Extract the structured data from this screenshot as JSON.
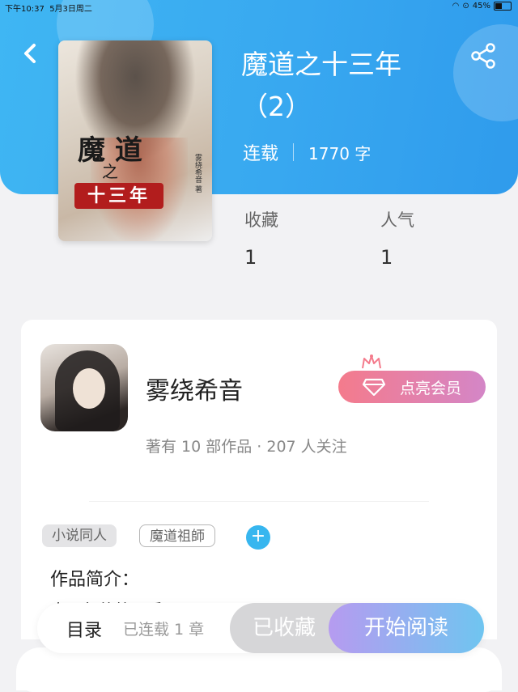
{
  "status_bar": {
    "time": "下午10:37",
    "date": "5月3日周二",
    "battery": "45%"
  },
  "book": {
    "title": "魔道之十三年（2）",
    "status": "连载",
    "word_count": "1770 字",
    "cover_title_top": "魔 道",
    "cover_title_mid": "之",
    "cover_banner": "十三年",
    "cover_author": "雾绕希音 著"
  },
  "stats": {
    "favorites_label": "收藏",
    "favorites_value": "1",
    "popularity_label": "人气",
    "popularity_value": "1"
  },
  "author": {
    "name": "雾绕希音",
    "vip_label": "点亮会员",
    "works_info": "著有 10 部作品 · 207 人关注"
  },
  "tags": [
    "小说同人",
    "魔道祖師"
  ],
  "intro": {
    "label": "作品简介：",
    "text": "十三年的第二季"
  },
  "bottom_bar": {
    "toc_label": "目录",
    "chapters": "已连载 1 章",
    "favorited_label": "已收藏",
    "read_label": "开始阅读"
  },
  "colors": {
    "header": "#38a8f0",
    "accent": "#37b6ef",
    "vip": "#f47b8c"
  },
  "icons": [
    "back-icon",
    "share-icon",
    "crown-icon",
    "diamond-icon",
    "plus-icon"
  ]
}
